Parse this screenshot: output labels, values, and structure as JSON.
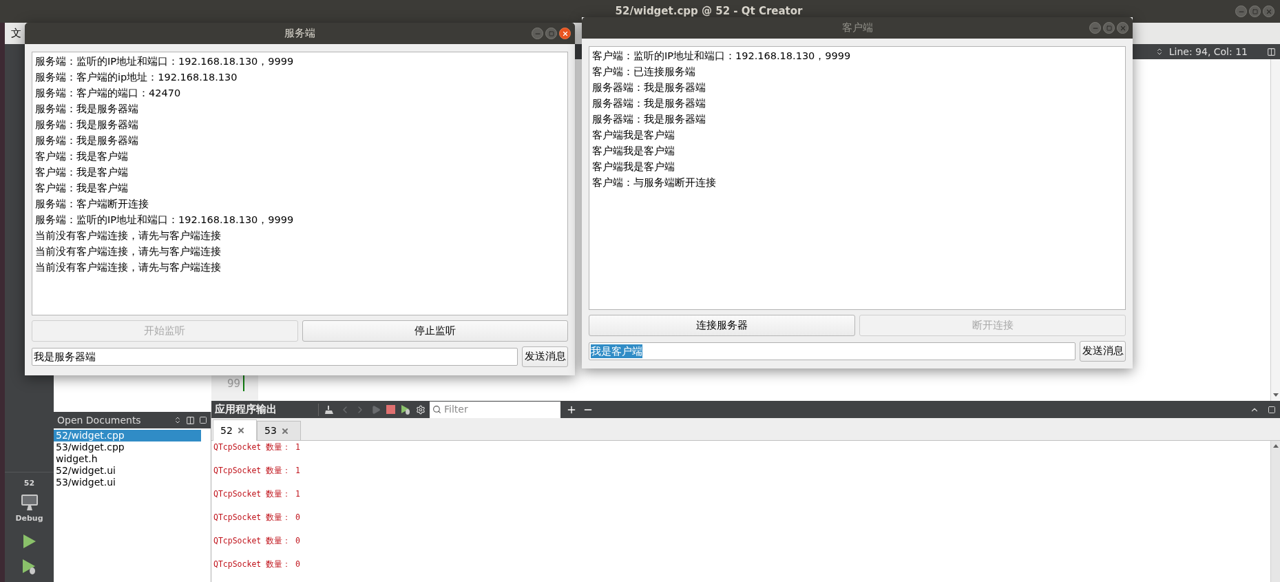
{
  "ide": {
    "title": "52/widget.cpp @ 52 - Qt Creator",
    "menu": [
      "文"
    ],
    "cursor_position": "Line: 94, Col: 11",
    "line_number": "99"
  },
  "mode_bar": {
    "project": "52",
    "config": "Debug"
  },
  "open_documents": {
    "title": "Open Documents",
    "items": [
      {
        "label": "52/widget.cpp",
        "selected": true
      },
      {
        "label": "53/widget.cpp",
        "selected": false
      },
      {
        "label": "widget.h",
        "selected": false
      },
      {
        "label": "52/widget.ui",
        "selected": false
      },
      {
        "label": "53/widget.ui",
        "selected": false
      }
    ]
  },
  "output": {
    "title": "应用程序输出",
    "filter": {
      "placeholder": "Filter"
    },
    "tabs": [
      {
        "label": "52",
        "selected": true
      },
      {
        "label": "53",
        "selected": false
      }
    ],
    "lines": [
      "QTcpSocket 数量： 1",
      "QTcpSocket 数量： 1",
      "QTcpSocket 数量： 1",
      "QTcpSocket 数量： 0",
      "QTcpSocket 数量： 0",
      "QTcpSocket 数量： 0"
    ]
  },
  "windows": [
    {
      "title": "服务端",
      "active": true,
      "log": [
        "服务端：监听的IP地址和端口：192.168.18.130，9999",
        "服务端：客户端的ip地址：192.168.18.130",
        "服务端：客户端的端口：42470",
        "服务端：我是服务器端",
        "服务端：我是服务器端",
        "服务端：我是服务器端",
        "客户端：我是客户端",
        "客户端：我是客户端",
        "客户端：我是客户端",
        "服务端：客户端断开连接",
        "服务端：监听的IP地址和端口：192.168.18.130，9999",
        "当前没有客户端连接，请先与客户端连接",
        "当前没有客户端连接，请先与客户端连接",
        "当前没有客户端连接，请先与客户端连接"
      ],
      "buttons": [
        {
          "label": "开始监听",
          "disabled": true
        },
        {
          "label": "停止监听",
          "disabled": false
        }
      ],
      "input": {
        "value": "我是服务器端",
        "selected": false
      },
      "send_button": "发送消息"
    },
    {
      "title": "客户端",
      "active": false,
      "log": [
        "客户端：监听的IP地址和端口：192.168.18.130，9999",
        "客户端：已连接服务端",
        "服务器端：我是服务器端",
        "服务器端：我是服务器端",
        "服务器端：我是服务器端",
        "客户端我是客户端",
        "客户端我是客户端",
        "客户端我是客户端",
        "客户端：与服务端断开连接"
      ],
      "buttons": [
        {
          "label": "连接服务器",
          "disabled": false
        },
        {
          "label": "断开连接",
          "disabled": true
        }
      ],
      "input": {
        "value": "我是客户端",
        "selected": true
      },
      "send_button": "发送消息"
    }
  ]
}
